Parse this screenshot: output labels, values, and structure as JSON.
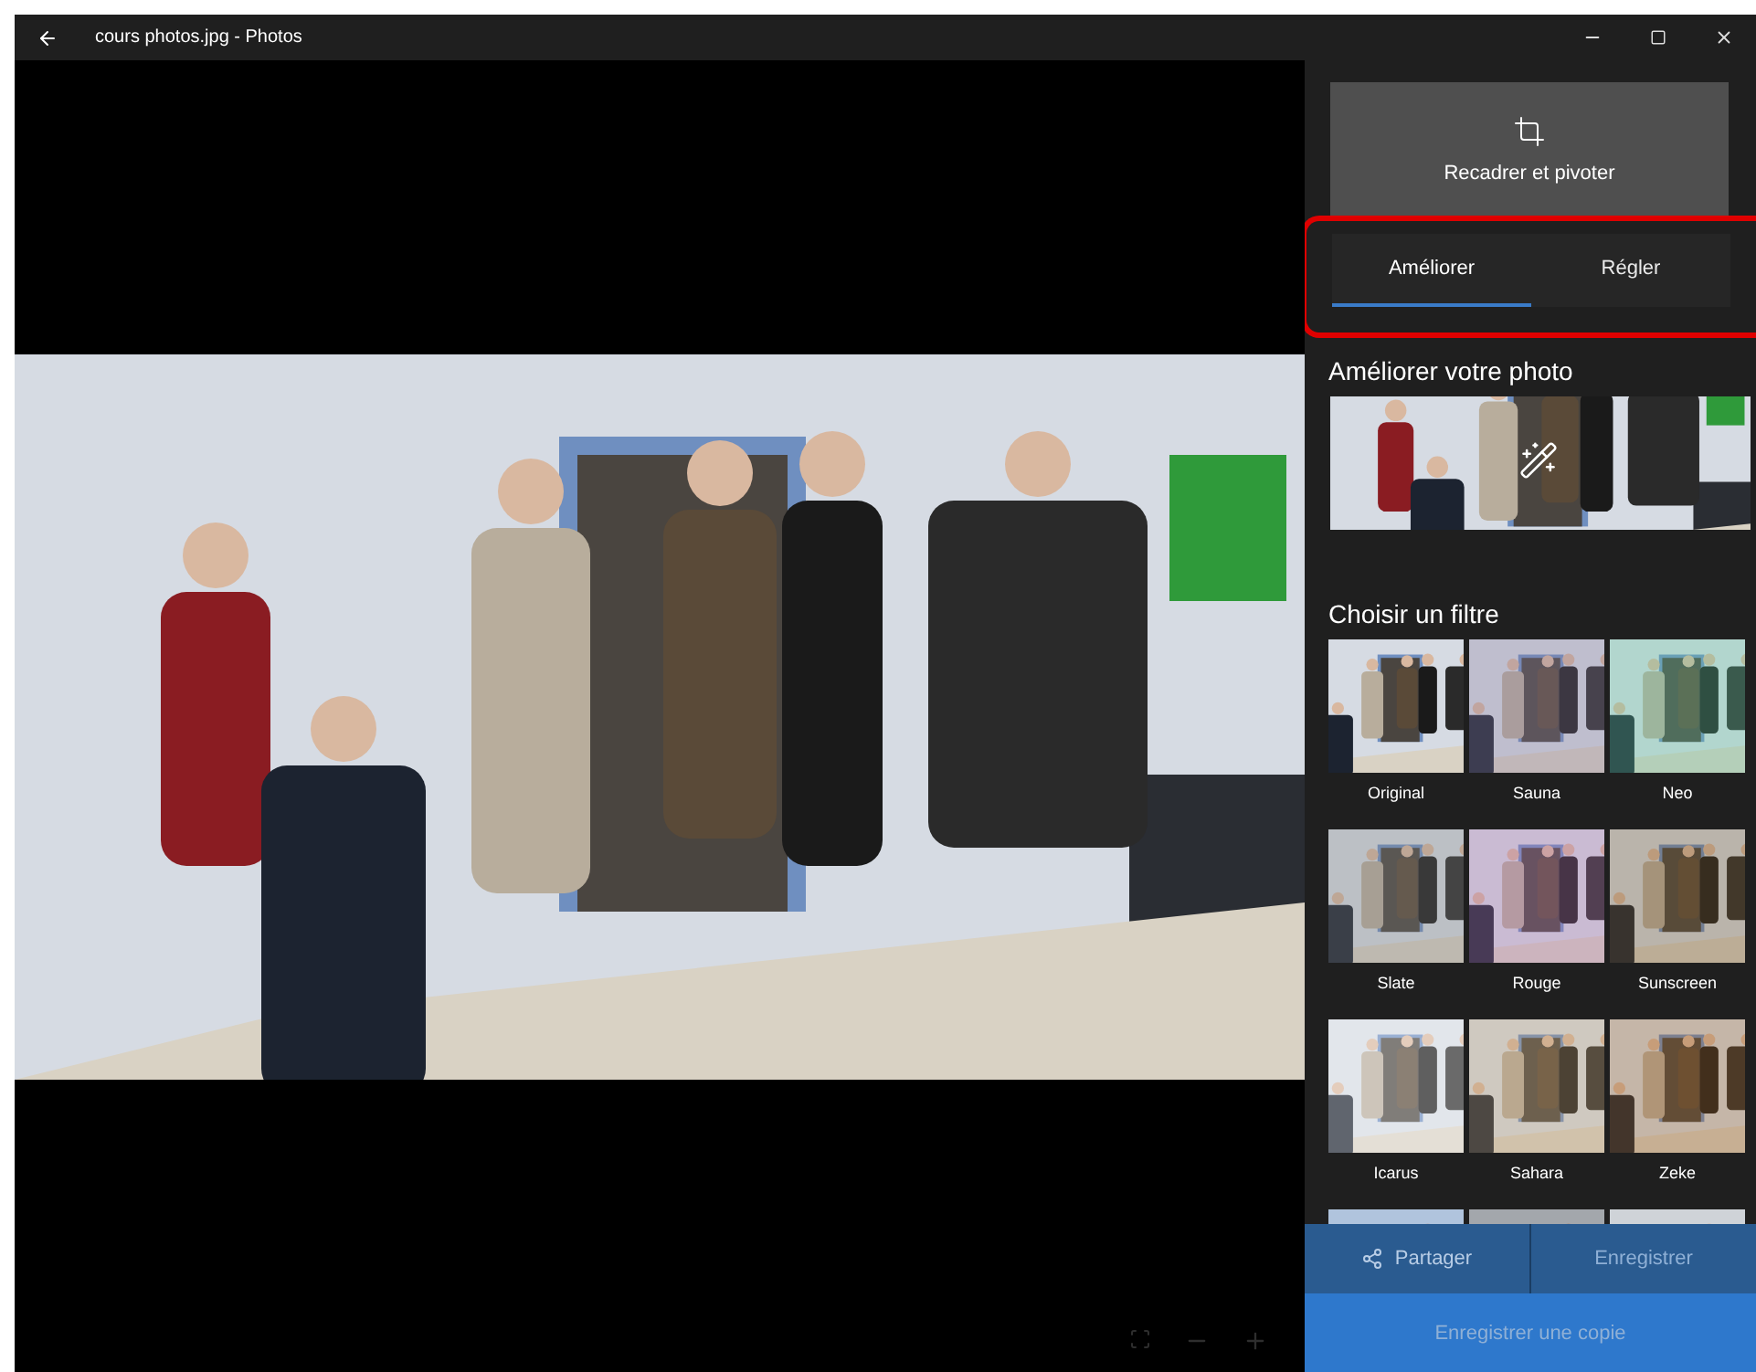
{
  "window": {
    "title": "cours photos.jpg - Photos"
  },
  "crop_button": {
    "label": "Recadrer et pivoter"
  },
  "tabs": {
    "highlighted": true,
    "items": [
      {
        "label": "Améliorer",
        "selected": true
      },
      {
        "label": "Régler",
        "selected": false
      }
    ]
  },
  "enhance": {
    "heading": "Améliorer votre photo"
  },
  "filters": {
    "heading": "Choisir un filtre",
    "items": [
      {
        "kind": "filter",
        "label": "Original"
      },
      {
        "kind": "filter",
        "label": "Sauna"
      },
      {
        "kind": "filter",
        "label": "Neo"
      },
      {
        "kind": "filter",
        "label": "Slate"
      },
      {
        "kind": "filter",
        "label": "Rouge"
      },
      {
        "kind": "filter",
        "label": "Sunscreen"
      },
      {
        "kind": "filter",
        "label": "Icarus"
      },
      {
        "kind": "filter",
        "label": "Sahara"
      },
      {
        "kind": "filter",
        "label": "Zeke"
      },
      {
        "kind": "partial"
      },
      {
        "kind": "partial"
      },
      {
        "kind": "partial"
      }
    ]
  },
  "actions": [
    {
      "kind": "share",
      "label": "Partager",
      "disabled": false
    },
    {
      "kind": "save",
      "label": "Enregistrer",
      "disabled": true
    },
    {
      "kind": "copy",
      "label": "Enregistrer une copie",
      "disabled": true
    }
  ]
}
